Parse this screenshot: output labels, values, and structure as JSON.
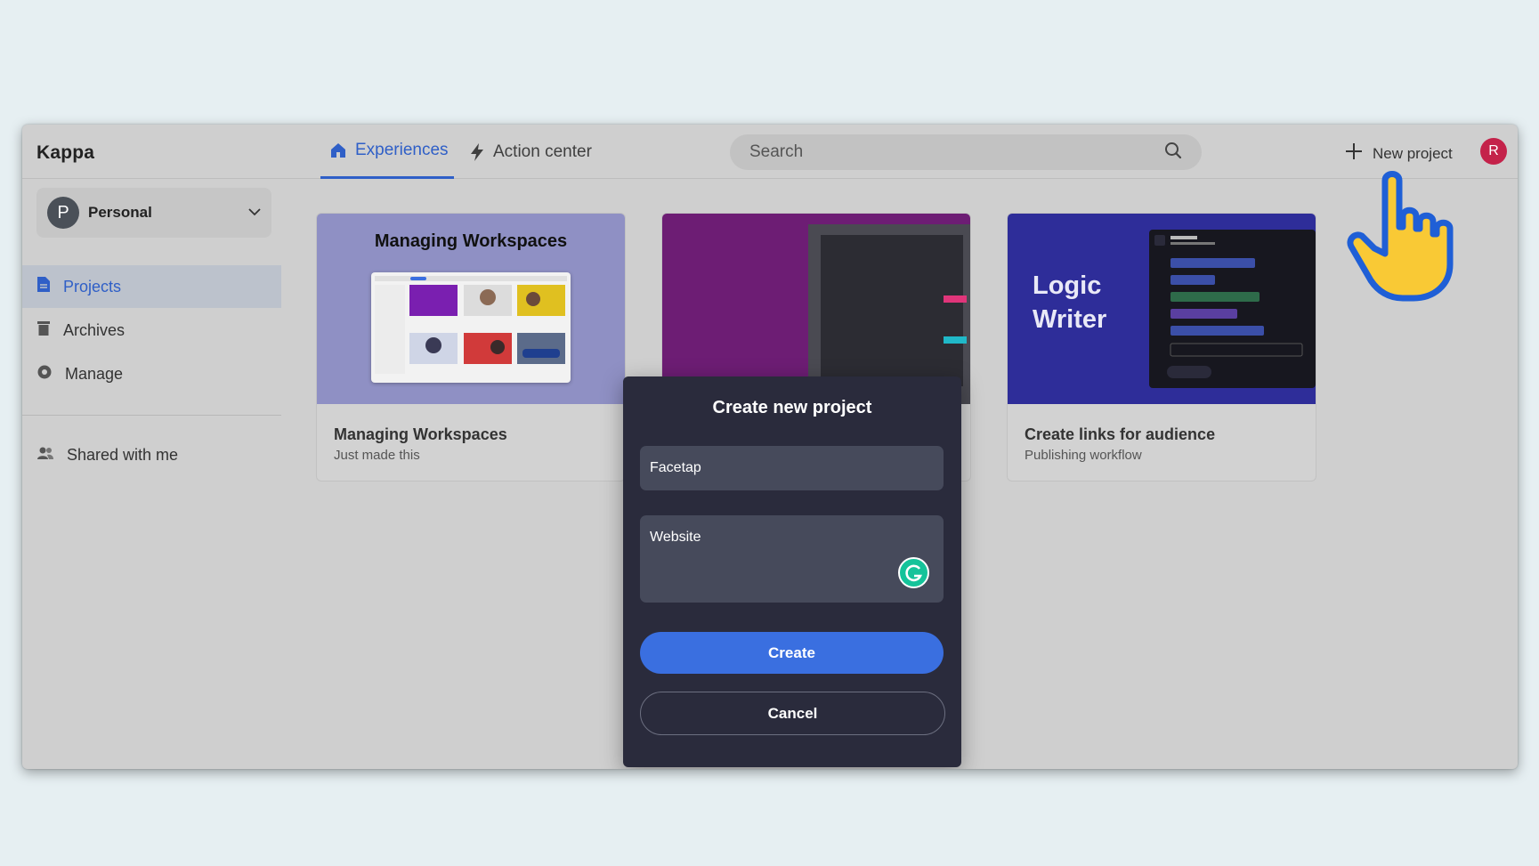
{
  "app": {
    "name": "Kappa"
  },
  "tabs": [
    {
      "label": "Experiences",
      "icon": "home-icon",
      "active": true
    },
    {
      "label": "Action center",
      "icon": "lightning-icon",
      "active": false
    }
  ],
  "search": {
    "placeholder": "Search"
  },
  "header": {
    "new_project_label": "New project",
    "avatar_initial": "R"
  },
  "colors": {
    "accent": "#2f5fc7",
    "primary_button": "#3a6fe0",
    "avatar": "#c4224a",
    "dialog_bg": "#2a2b3c",
    "hand": "#f9c935"
  },
  "workspace": {
    "initial": "P",
    "label": "Personal"
  },
  "sidebar": {
    "items": [
      {
        "label": "Projects",
        "icon": "document-icon",
        "active": true
      },
      {
        "label": "Archives",
        "icon": "trash-icon",
        "active": false
      },
      {
        "label": "Manage",
        "icon": "gear-icon",
        "active": false
      }
    ],
    "shared": {
      "label": "Shared with me",
      "icon": "users-icon"
    }
  },
  "cards": [
    {
      "thumb_heading": "Managing Workspaces",
      "title": "Managing Workspaces",
      "subtitle": "Just made this"
    },
    {
      "title": "",
      "subtitle": ""
    },
    {
      "thumb_heading_line1": "Logic",
      "thumb_heading_line2": "Writer",
      "title": "Create links for audience",
      "subtitle": "Publishing workflow"
    }
  ],
  "dialog": {
    "title": "Create new project",
    "name_value": "Facetap",
    "description_value": "Website",
    "create_label": "Create",
    "cancel_label": "Cancel"
  }
}
